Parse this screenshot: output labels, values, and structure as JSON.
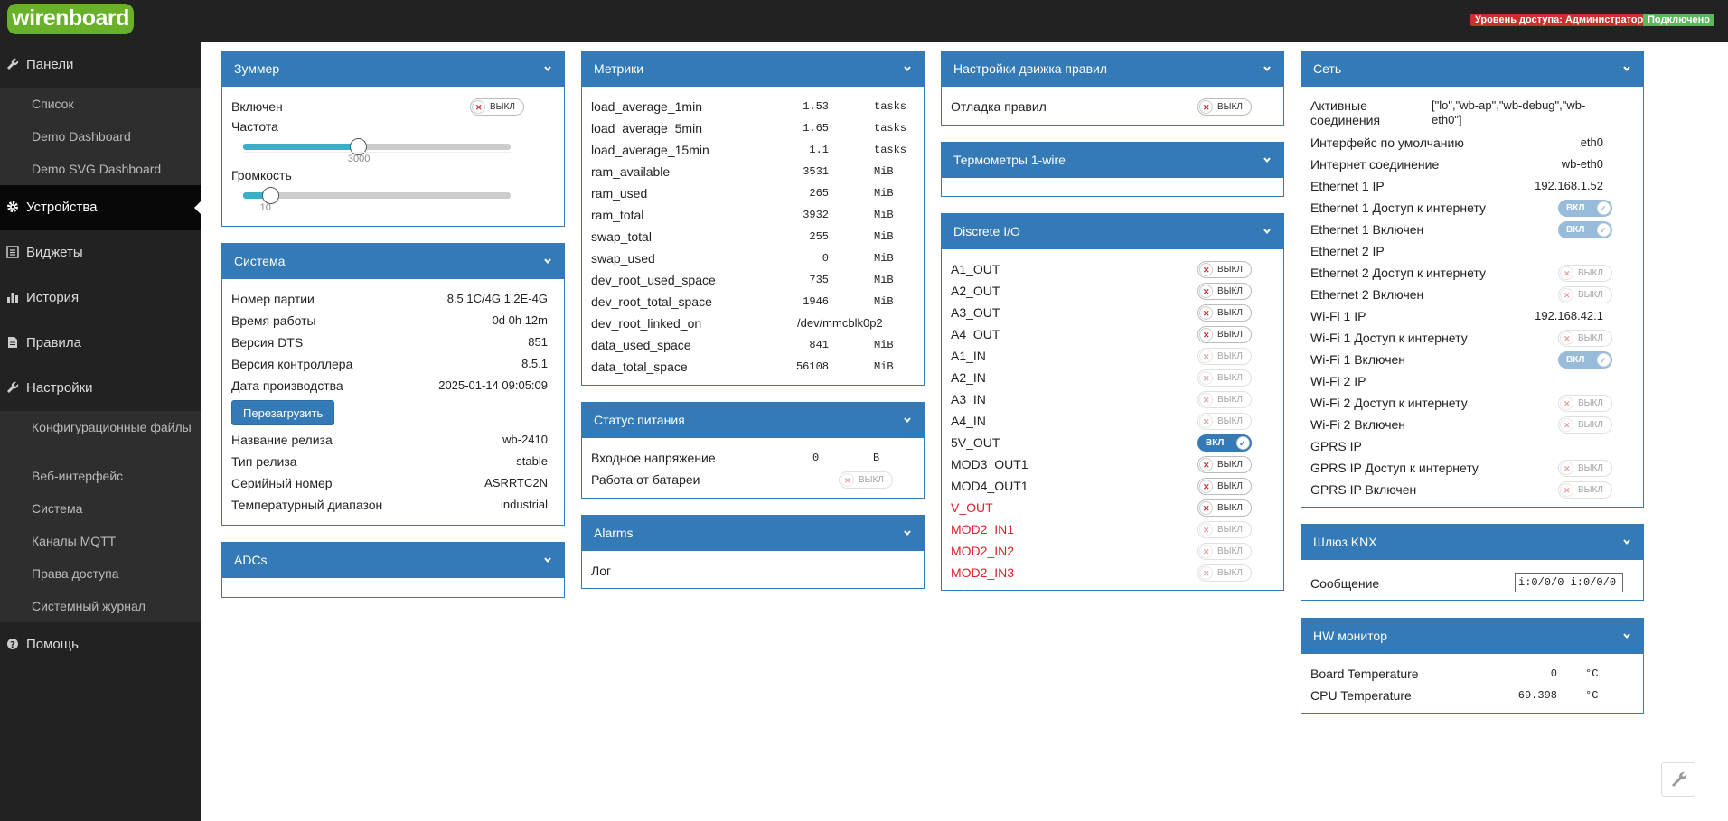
{
  "header": {
    "logo": "wirenboard",
    "access_badge": "Уровень доступа: Администратор",
    "status_badge": "Подключено"
  },
  "sidebar": {
    "panels": "Панели",
    "panel_items": [
      "Список",
      "Demo Dashboard",
      "Demo SVG Dashboard"
    ],
    "devices": "Устройства",
    "widgets": "Виджеты",
    "history": "История",
    "rules": "Правила",
    "settings": "Настройки",
    "settings_items": [
      "Конфигурационные файлы",
      "Веб-интерфейс",
      "Система",
      "Каналы MQTT",
      "Права доступа",
      "Системный журнал"
    ],
    "help": "Помощь"
  },
  "switch_off": "ВЫКЛ",
  "switch_on": "ВКЛ",
  "buzzer": {
    "title": "Зуммер",
    "enabled_label": "Включен",
    "freq_label": "Частота",
    "freq_value": 3000,
    "freq_max": 7000,
    "volume_label": "Громкость",
    "volume_value": 10,
    "volume_max": 100
  },
  "system": {
    "title": "Система",
    "rows": [
      {
        "label": "Номер партии",
        "value": "8.5.1C/4G 1.2E-4G"
      },
      {
        "label": "Время работы",
        "value": "0d 0h 12m"
      },
      {
        "label": "Версия DTS",
        "value": "851"
      },
      {
        "label": "Версия контроллера",
        "value": "8.5.1"
      },
      {
        "label": "Дата производства",
        "value": "2025-01-14 09:05:09"
      }
    ],
    "reboot_button": "Перезагрузить",
    "rows2": [
      {
        "label": "Название релиза",
        "value": "wb-2410"
      },
      {
        "label": "Тип релиза",
        "value": "stable"
      },
      {
        "label": "Серийный номер",
        "value": "ASRRTC2N"
      },
      {
        "label": "Температурный диапазон",
        "value": "industrial"
      }
    ]
  },
  "adcs": {
    "title": "ADCs"
  },
  "metrics": {
    "title": "Метрики",
    "rows": [
      {
        "label": "load_average_1min",
        "value": "1.53",
        "unit": "tasks"
      },
      {
        "label": "load_average_5min",
        "value": "1.65",
        "unit": "tasks"
      },
      {
        "label": "load_average_15min",
        "value": "1.1",
        "unit": "tasks"
      },
      {
        "label": "ram_available",
        "value": "3531",
        "unit": "MiB"
      },
      {
        "label": "ram_used",
        "value": "265",
        "unit": "MiB"
      },
      {
        "label": "ram_total",
        "value": "3932",
        "unit": "MiB"
      },
      {
        "label": "swap_total",
        "value": "255",
        "unit": "MiB"
      },
      {
        "label": "swap_used",
        "value": "0",
        "unit": "MiB"
      },
      {
        "label": "dev_root_used_space",
        "value": "735",
        "unit": "MiB"
      },
      {
        "label": "dev_root_total_space",
        "value": "1946",
        "unit": "MiB"
      },
      {
        "label": "dev_root_linked_on",
        "value": "/dev/mmcblk0p2",
        "unit": ""
      },
      {
        "label": "data_used_space",
        "value": "841",
        "unit": "MiB"
      },
      {
        "label": "data_total_space",
        "value": "56108",
        "unit": "MiB"
      }
    ]
  },
  "power": {
    "title": "Статус питания",
    "voltage_label": "Входное напряжение",
    "voltage_value": "0",
    "voltage_unit": "В",
    "battery_label": "Работа от батареи"
  },
  "alarms": {
    "title": "Alarms",
    "log_label": "Лог"
  },
  "rule_engine": {
    "title": "Настройки движка правил",
    "debug_label": "Отладка правил"
  },
  "onewire": {
    "title": "Термометры 1-wire"
  },
  "dio": {
    "title": "Discrete I/O",
    "rows": [
      {
        "label": "A1_OUT",
        "state": "off",
        "disabled": false,
        "red": false
      },
      {
        "label": "A2_OUT",
        "state": "off",
        "disabled": false,
        "red": false
      },
      {
        "label": "A3_OUT",
        "state": "off",
        "disabled": false,
        "red": false
      },
      {
        "label": "A4_OUT",
        "state": "off",
        "disabled": false,
        "red": false
      },
      {
        "label": "A1_IN",
        "state": "off",
        "disabled": true,
        "red": false
      },
      {
        "label": "A2_IN",
        "state": "off",
        "disabled": true,
        "red": false
      },
      {
        "label": "A3_IN",
        "state": "off",
        "disabled": true,
        "red": false
      },
      {
        "label": "A4_IN",
        "state": "off",
        "disabled": true,
        "red": false
      },
      {
        "label": "5V_OUT",
        "state": "on",
        "disabled": false,
        "red": false
      },
      {
        "label": "MOD3_OUT1",
        "state": "off",
        "disabled": false,
        "red": false
      },
      {
        "label": "MOD4_OUT1",
        "state": "off",
        "disabled": false,
        "red": false
      },
      {
        "label": "V_OUT",
        "state": "off",
        "disabled": false,
        "red": true
      },
      {
        "label": "MOD2_IN1",
        "state": "off",
        "disabled": true,
        "red": true
      },
      {
        "label": "MOD2_IN2",
        "state": "off",
        "disabled": true,
        "red": true
      },
      {
        "label": "MOD2_IN3",
        "state": "off",
        "disabled": true,
        "red": true
      }
    ]
  },
  "network": {
    "title": "Сеть",
    "active_label": "Активные соединения",
    "active_value": "[\"lo\",\"wb-ap\",\"wb-debug\",\"wb-eth0\"]",
    "rows": [
      {
        "label": "Интерфейс по умолчанию",
        "type": "text",
        "value": "eth0"
      },
      {
        "label": "Интернет соединение",
        "type": "text",
        "value": "wb-eth0"
      },
      {
        "label": "Ethernet 1 IP",
        "type": "text",
        "value": "192.168.1.52"
      },
      {
        "label": "Ethernet 1 Доступ к интернету",
        "type": "switch",
        "state": "on"
      },
      {
        "label": "Ethernet 1 Включен",
        "type": "switch",
        "state": "on"
      },
      {
        "label": "Ethernet 2 IP",
        "type": "text",
        "value": ""
      },
      {
        "label": "Ethernet 2 Доступ к интернету",
        "type": "switch",
        "state": "off"
      },
      {
        "label": "Ethernet 2 Включен",
        "type": "switch",
        "state": "off"
      },
      {
        "label": "Wi-Fi 1 IP",
        "type": "text",
        "value": "192.168.42.1"
      },
      {
        "label": "Wi-Fi 1 Доступ к интернету",
        "type": "switch",
        "state": "off"
      },
      {
        "label": "Wi-Fi 1 Включен",
        "type": "switch",
        "state": "on"
      },
      {
        "label": "Wi-Fi 2 IP",
        "type": "text",
        "value": ""
      },
      {
        "label": "Wi-Fi 2 Доступ к интернету",
        "type": "switch",
        "state": "off"
      },
      {
        "label": "Wi-Fi 2 Включен",
        "type": "switch",
        "state": "off"
      },
      {
        "label": "GPRS IP",
        "type": "text",
        "value": ""
      },
      {
        "label": "GPRS IP Доступ к интернету",
        "type": "switch",
        "state": "off"
      },
      {
        "label": "GPRS IP Включен",
        "type": "switch",
        "state": "off"
      }
    ]
  },
  "knx": {
    "title": "Шлюз KNX",
    "message_label": "Сообщение",
    "message_value": "i:0/0/0 i:0/0/0"
  },
  "hw": {
    "title": "HW монитор",
    "rows": [
      {
        "label": "Board Temperature",
        "value": "0",
        "unit": "°C"
      },
      {
        "label": "CPU Temperature",
        "value": "69.398",
        "unit": "°C"
      }
    ]
  },
  "colors": {
    "accent": "#337ab7",
    "sidebar": "#222222",
    "logo": "#6ab12a",
    "danger": "#c9302c",
    "success": "#5cb85c"
  }
}
